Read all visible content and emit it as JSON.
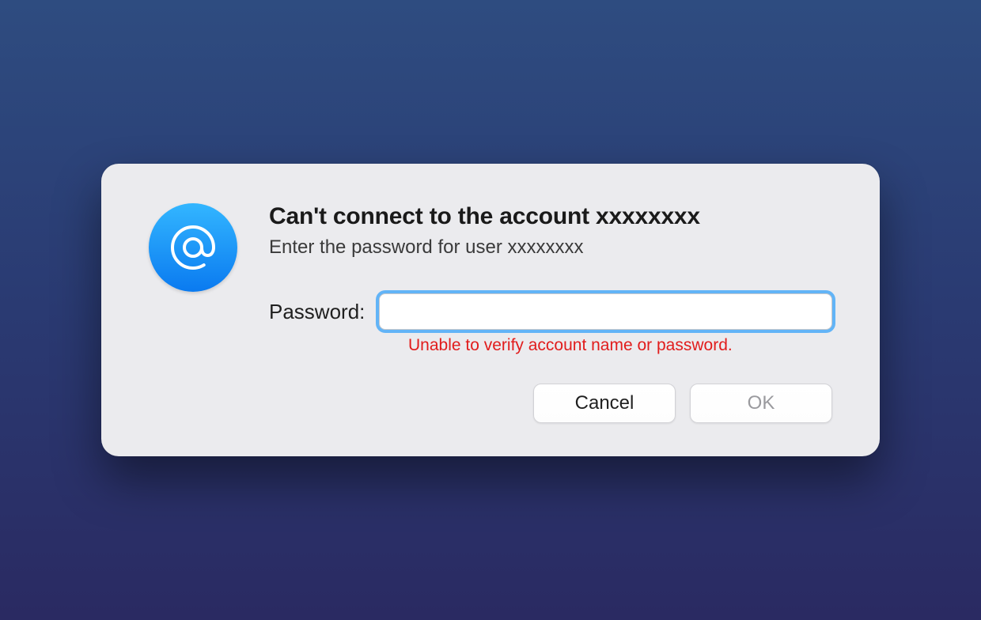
{
  "dialog": {
    "title": "Can't connect to the account xxxxxxxx",
    "subtitle": "Enter the password for user xxxxxxxx",
    "password_label": "Password:",
    "password_value": "",
    "error_message": "Unable to verify account name or password.",
    "cancel_label": "Cancel",
    "ok_label": "OK",
    "icon_name": "at-icon"
  },
  "colors": {
    "error": "#e11c1c",
    "focus_ring": "#62b4f7",
    "icon_gradient_top": "#33b6ff",
    "icon_gradient_bottom": "#0a7af0"
  }
}
